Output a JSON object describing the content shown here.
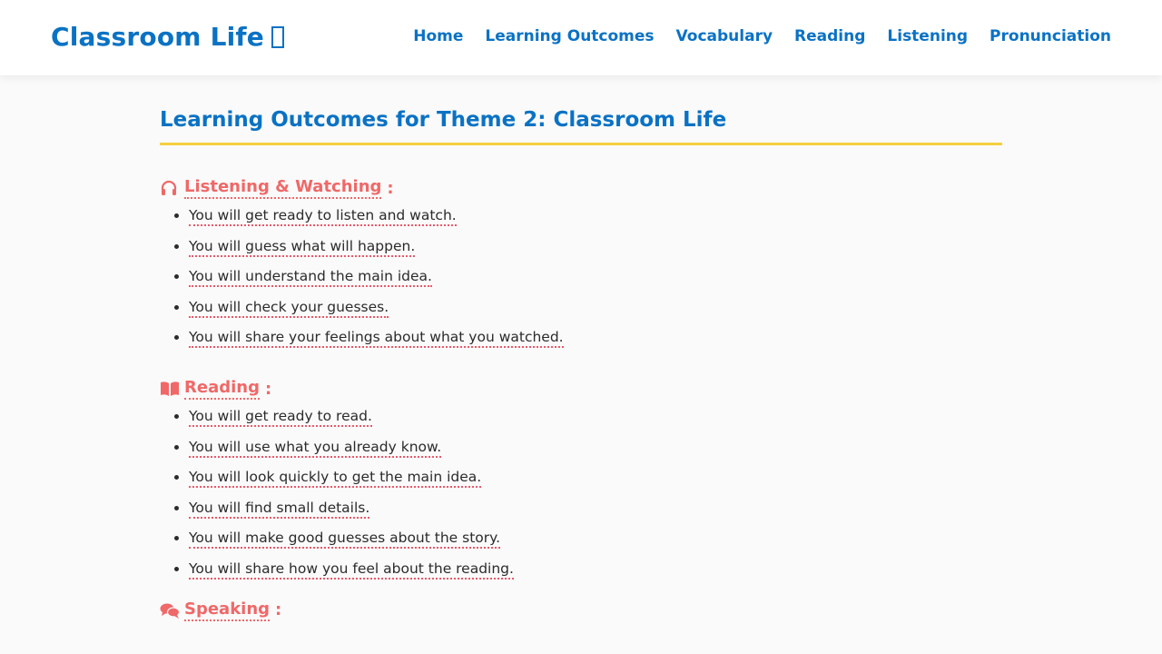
{
  "header": {
    "brand": "Classroom Life",
    "nav": [
      "Home",
      "Learning Outcomes",
      "Vocabulary",
      "Reading",
      "Listening",
      "Pronunciation"
    ]
  },
  "page": {
    "title": "Learning Outcomes for Theme 2: Classroom Life"
  },
  "sections": [
    {
      "icon": "headphones-icon",
      "heading": "Listening & Watching",
      "items": [
        "You will get ready to listen and watch.",
        "You will guess what will happen.",
        "You will understand the main idea.",
        "You will check your guesses.",
        "You will share your feelings about what you watched."
      ]
    },
    {
      "icon": "book-icon",
      "heading": "Reading",
      "items": [
        "You will get ready to read.",
        "You will use what you already know.",
        "You will look quickly to get the main idea.",
        "You will find small details.",
        "You will make good guesses about the story.",
        "You will share how you feel about the reading."
      ]
    },
    {
      "icon": "speech-bubbles-icon",
      "heading": "Speaking",
      "items": []
    }
  ],
  "colors": {
    "accent_blue": "#0a72c4",
    "heading_coral": "#f06868",
    "title_underline": "#f4d03f"
  }
}
